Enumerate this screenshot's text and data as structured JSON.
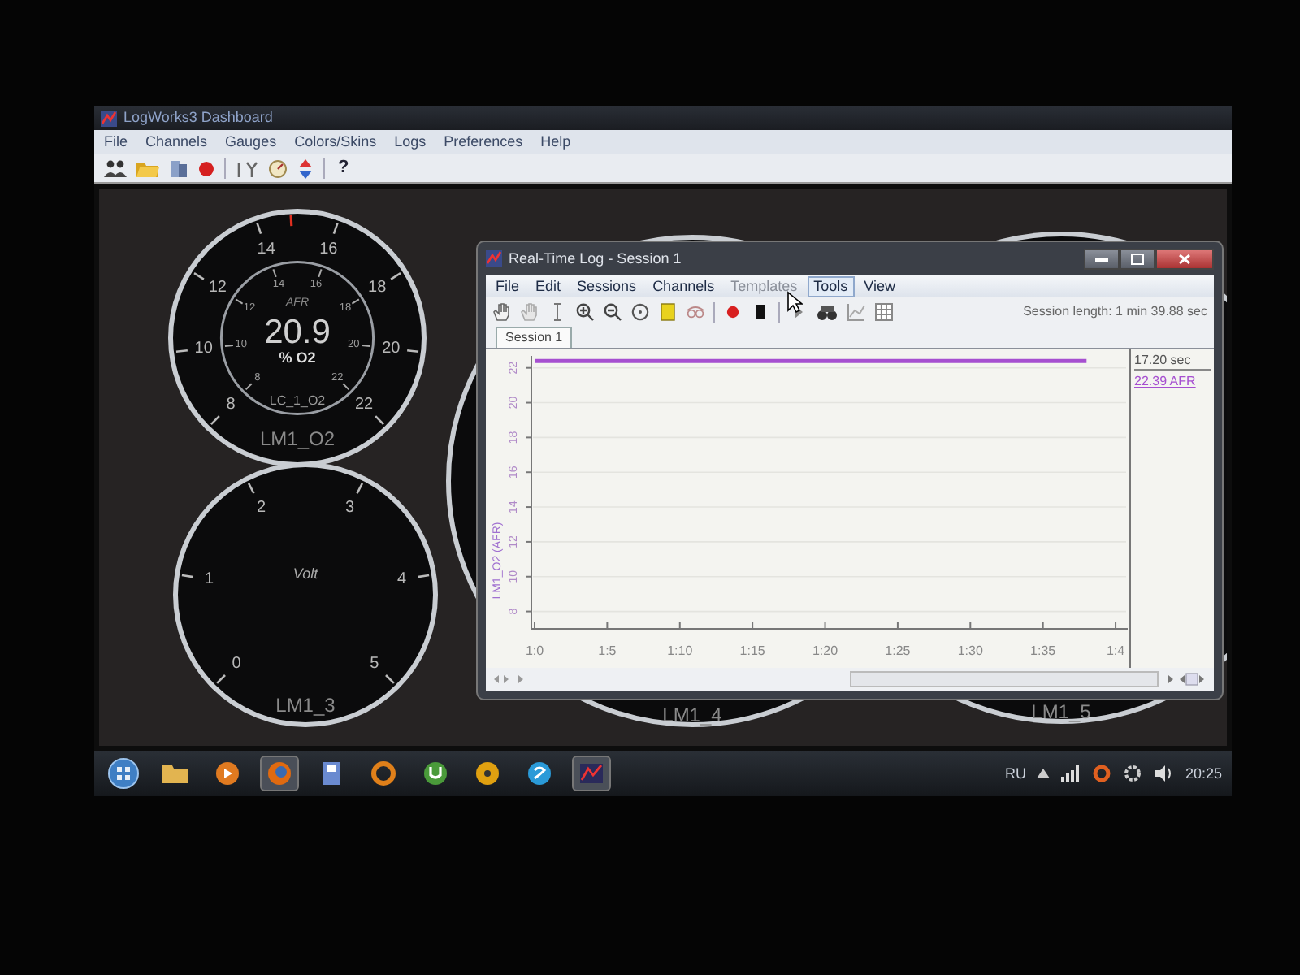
{
  "dashboard": {
    "title": "LogWorks3 Dashboard",
    "menu": [
      "File",
      "Channels",
      "Gauges",
      "Colors/Skins",
      "Logs",
      "Preferences",
      "Help"
    ],
    "help_button": "?"
  },
  "gauges": [
    {
      "kind": "dual",
      "name": "LM1_O2",
      "caption": "AFR",
      "reading": "20.9",
      "unit": "% O2",
      "channel": "LC_1_O2",
      "outer_ticks": [
        "8",
        "10",
        "12",
        "14",
        "16",
        "18",
        "20",
        "22"
      ],
      "inner_ticks": [
        "8",
        "10",
        "12",
        "14",
        "16",
        "18",
        "20",
        "22"
      ]
    },
    {
      "kind": "single",
      "name": "LM1_3",
      "caption": "Volt",
      "outer_ticks": [
        "0",
        "1",
        "2",
        "3",
        "4",
        "5"
      ]
    },
    {
      "kind": "covered",
      "name": "LM1_4"
    },
    {
      "kind": "covered",
      "name": "LM1_5"
    }
  ],
  "log_window": {
    "title": "Real-Time Log - Session 1",
    "menu": [
      {
        "label": "File",
        "disabled": false,
        "highlighted": false
      },
      {
        "label": "Edit",
        "disabled": false,
        "highlighted": false
      },
      {
        "label": "Sessions",
        "disabled": false,
        "highlighted": false
      },
      {
        "label": "Channels",
        "disabled": false,
        "highlighted": false
      },
      {
        "label": "Templates",
        "disabled": true,
        "highlighted": false
      },
      {
        "label": "Tools",
        "disabled": false,
        "highlighted": true
      },
      {
        "label": "View",
        "disabled": false,
        "highlighted": false
      }
    ],
    "session_length": "Session length:  1 min 39.88 sec",
    "tabs": [
      {
        "label": "Session 1",
        "selected": true
      }
    ],
    "chart_data": {
      "type": "line",
      "ylabel": "LM1_O2 (AFR)",
      "x": [
        60,
        98
      ],
      "series": [
        {
          "color": "#a64fd0",
          "values": [
            22.4,
            22.4
          ]
        }
      ],
      "grid": true,
      "xlim": [
        60,
        100.5
      ],
      "ylim": [
        7,
        22.5
      ],
      "yticks": [
        8,
        10,
        12,
        14,
        16,
        18,
        20,
        22
      ],
      "xticks": [
        {
          "value": 60,
          "label": "1:0"
        },
        {
          "value": 65,
          "label": "1:5"
        },
        {
          "value": 70,
          "label": "1:10"
        },
        {
          "value": 75,
          "label": "1:15"
        },
        {
          "value": 80,
          "label": "1:20"
        },
        {
          "value": 85,
          "label": "1:25"
        },
        {
          "value": 90,
          "label": "1:30"
        },
        {
          "value": 95,
          "label": "1:35"
        },
        {
          "value": 100,
          "label": "1:4"
        }
      ]
    },
    "cursor_time": "17.20 sec",
    "cursor_value": "22.39 AFR"
  },
  "taskbar": {
    "language": "RU",
    "clock": "20:25"
  }
}
